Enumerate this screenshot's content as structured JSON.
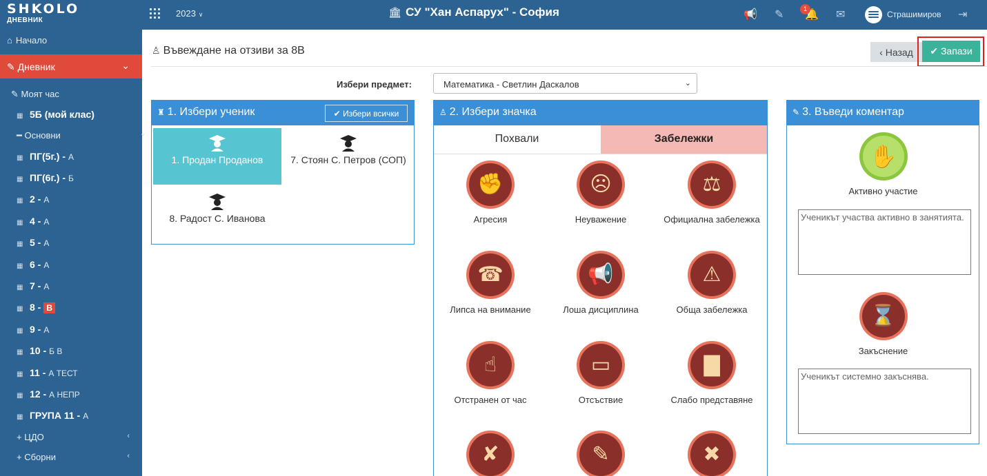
{
  "header": {
    "logo": "SHKOLO",
    "logo_sub": "ДНЕВНИК",
    "year": "2023",
    "school": "СУ \"Хан Аспарух\" - София",
    "notification_count": "1",
    "user": "Страшимиров",
    "icons": [
      "apps-grid-icon",
      "megaphone-icon",
      "edit-icon",
      "bell-icon",
      "envelope-icon",
      "logout-icon"
    ]
  },
  "sidebar": {
    "home": "Начало",
    "diary": "Дневник",
    "my_hour": "Моят час",
    "my_class": "5Б (мой клас)",
    "main_group": "Основни",
    "classes": [
      {
        "name": "ПГ(5г.) -",
        "letters": "А"
      },
      {
        "name": "ПГ(6г.) -",
        "letters": "Б"
      },
      {
        "name": "2 -",
        "letters": "А"
      },
      {
        "name": "4 -",
        "letters": "А"
      },
      {
        "name": "5 -",
        "letters": "А"
      },
      {
        "name": "6 -",
        "letters": "А"
      },
      {
        "name": "7 -",
        "letters": "А"
      },
      {
        "name": "8 -",
        "letters": "В"
      },
      {
        "name": "9 -",
        "letters": "А"
      },
      {
        "name": "10 -",
        "letters": "Б В"
      },
      {
        "name": "11 -",
        "letters": "А ТЕСТ"
      },
      {
        "name": "12 -",
        "letters": "А НЕПР"
      },
      {
        "name": "ГРУПА 11 -",
        "letters": "А"
      }
    ],
    "cdo": "ЦДО",
    "combined": "Сборни"
  },
  "page": {
    "title": "Въвеждане на отзиви за 8В",
    "back": "Назад",
    "save": "Запази",
    "subject_label": "Избери предмет:",
    "subject_value": "Математика - Светлин Даскалов"
  },
  "students_panel": {
    "title": "1. Избери ученик",
    "select_all": "Избери всички",
    "students": [
      "1. Продан Проданов",
      "7. Стоян С. Петров (СОП)",
      "8. Радост С. Иванова"
    ]
  },
  "badge_panel": {
    "title": "2. Избери значка",
    "tabs": [
      "Похвали",
      "Забележки"
    ],
    "badges": [
      {
        "label": "Агресия",
        "icon": "fist-icon"
      },
      {
        "label": "Неуважение",
        "icon": "mocking-face-icon"
      },
      {
        "label": "Официална забележка",
        "icon": "gavel-icon"
      },
      {
        "label": "Липса на внимание",
        "icon": "phone-user-icon"
      },
      {
        "label": "Лоша дисциплина",
        "icon": "megaphone-icon"
      },
      {
        "label": "Обща забележка",
        "icon": "warning-icon"
      },
      {
        "label": "Отстранен от час",
        "icon": "expelled-icon"
      },
      {
        "label": "Отсъствие",
        "icon": "empty-desk-icon"
      },
      {
        "label": "Слабо представяне",
        "icon": "declining-chart-icon"
      },
      {
        "label": "",
        "icon": "no-homework-icon"
      },
      {
        "label": "",
        "icon": "no-materials-icon"
      },
      {
        "label": "",
        "icon": "no-book-icon"
      }
    ]
  },
  "comment_panel": {
    "title": "3. Въведи коментар",
    "items": [
      {
        "label": "Активно участие",
        "icon": "raised-hand-icon",
        "text": "Ученикът участва активно в занятията."
      },
      {
        "label": "Закъснение",
        "icon": "hourglass-icon",
        "text": "Ученикът системно закъснява."
      }
    ]
  }
}
